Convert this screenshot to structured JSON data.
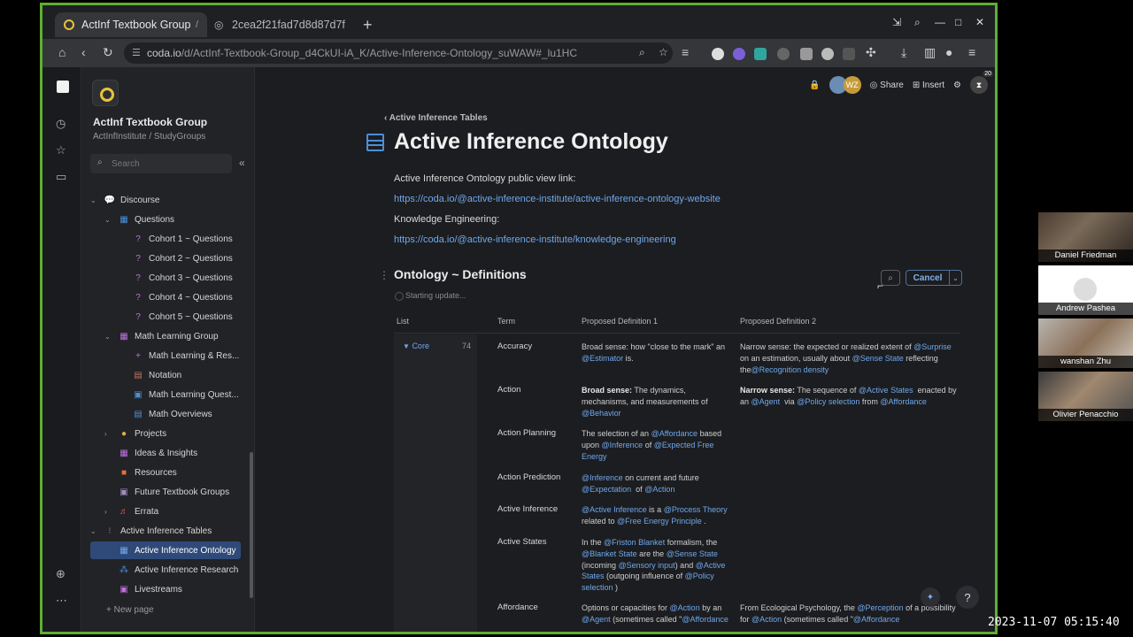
{
  "browser": {
    "tabs": [
      {
        "title": "ActInf Textbook Group",
        "close": "/"
      },
      {
        "title": "2cea2f21fad7d8d87d7f",
        "close": ""
      }
    ],
    "new_tab": "+",
    "url_host": "coda.io",
    "url_path": "/d/ActInf-Textbook-Group_d4CkUI-iA_K/Active-Inference-Ontology_suWAW#_lu1HC"
  },
  "sidebar": {
    "doc_title": "ActInf Textbook Group",
    "doc_path": "ActInfInstitute / StudyGroups",
    "search_placeholder": "Search",
    "items": [
      {
        "label": "Discourse",
        "icon": "speech-bubbles-icon",
        "glyph": "💬",
        "color": "#e0b050",
        "chev": "⌄",
        "indent": 0
      },
      {
        "label": "Questions",
        "icon": "grid-icon",
        "glyph": "▦",
        "color": "#4a8fd8",
        "chev": "⌄",
        "indent": 1
      },
      {
        "label": "Cohort 1 ~ Questions",
        "icon": "question-icon",
        "glyph": "?",
        "color": "#c070e0",
        "chev": "",
        "indent": 2
      },
      {
        "label": "Cohort 2 ~ Questions",
        "icon": "question-icon",
        "glyph": "?",
        "color": "#c070e0",
        "chev": "",
        "indent": 2
      },
      {
        "label": "Cohort 3 ~ Questions",
        "icon": "question-icon",
        "glyph": "?",
        "color": "#c070e0",
        "chev": "",
        "indent": 2
      },
      {
        "label": "Cohort 4 ~ Questions",
        "icon": "question-icon",
        "glyph": "?",
        "color": "#c070e0",
        "chev": "",
        "indent": 2
      },
      {
        "label": "Cohort 5 ~ Questions",
        "icon": "question-icon",
        "glyph": "?",
        "color": "#c070e0",
        "chev": "",
        "indent": 2
      },
      {
        "label": "Math Learning Group",
        "icon": "grid-icon",
        "glyph": "▦",
        "color": "#c070e0",
        "chev": "⌄",
        "indent": 1
      },
      {
        "label": "Math Learning & Res...",
        "icon": "plus-icon",
        "glyph": "+",
        "color": "#c070e0",
        "chev": "",
        "indent": 2
      },
      {
        "label": "Notation",
        "icon": "table-icon",
        "glyph": "▤",
        "color": "#c07060",
        "chev": "",
        "indent": 2
      },
      {
        "label": "Math Learning Quest...",
        "icon": "chat-icon",
        "glyph": "▣",
        "color": "#4a8fd8",
        "chev": "",
        "indent": 2
      },
      {
        "label": "Math Overviews",
        "icon": "document-icon",
        "glyph": "▤",
        "color": "#4a8fd8",
        "chev": "",
        "indent": 2
      },
      {
        "label": "Projects",
        "icon": "palette-icon",
        "glyph": "●",
        "color": "#e0b050",
        "chev": "›",
        "indent": 1
      },
      {
        "label": "Ideas & Insights",
        "icon": "grid-icon",
        "glyph": "▦",
        "color": "#c070e0",
        "chev": "",
        "indent": 1
      },
      {
        "label": "Resources",
        "icon": "book-icon",
        "glyph": "■",
        "color": "#e07040",
        "chev": "",
        "indent": 1
      },
      {
        "label": "Future Textbook Groups",
        "icon": "image-icon",
        "glyph": "▣",
        "color": "#a090c0",
        "chev": "",
        "indent": 1
      },
      {
        "label": "Errata",
        "icon": "music-icon",
        "glyph": "♬",
        "color": "#e05050",
        "chev": "›",
        "indent": 1
      },
      {
        "label": "Active Inference Tables",
        "icon": "dots-icon",
        "glyph": "⁝",
        "color": "#888888",
        "chev": "⌄",
        "indent": 0
      },
      {
        "label": "Active Inference Ontology",
        "icon": "table-icon",
        "glyph": "▦",
        "color": "#6fa8ec",
        "chev": "",
        "indent": 1,
        "active": true
      },
      {
        "label": "Active Inference Research",
        "icon": "network-icon",
        "glyph": "⁂",
        "color": "#4a8fd8",
        "chev": "",
        "indent": 1
      },
      {
        "label": "Livestreams",
        "icon": "image-icon",
        "glyph": "▣",
        "color": "#c070e0",
        "chev": "",
        "indent": 1
      }
    ],
    "new_page": "+ New page"
  },
  "header": {
    "avatar_initials": "WZ",
    "share": "Share",
    "insert": "Insert",
    "badge": "20"
  },
  "page": {
    "breadcrumb": "‹  Active Inference Tables",
    "title": "Active Inference Ontology",
    "line1": "Active Inference Ontology public view link:",
    "link1": "https://coda.io/@active-inference-institute/active-inference-ontology-website",
    "line2": "Knowledge Engineering:",
    "link2": "https://coda.io/@active-inference-institute/knowledge-engineering",
    "section_title": "Ontology ~ Definitions",
    "status": "Starting update...",
    "cancel": "Cancel"
  },
  "table": {
    "columns": [
      "List",
      "Term",
      "Proposed Definition 1",
      "Proposed Definition 2"
    ],
    "group": {
      "label": "Core",
      "count": "74"
    }
  },
  "participants": [
    {
      "name": "Daniel Friedman"
    },
    {
      "name": "Andrew Pashea"
    },
    {
      "name": "wanshan Zhu"
    },
    {
      "name": "Olivier Penacchio"
    }
  ],
  "timestamp": "2023-11-07  05:15:40"
}
